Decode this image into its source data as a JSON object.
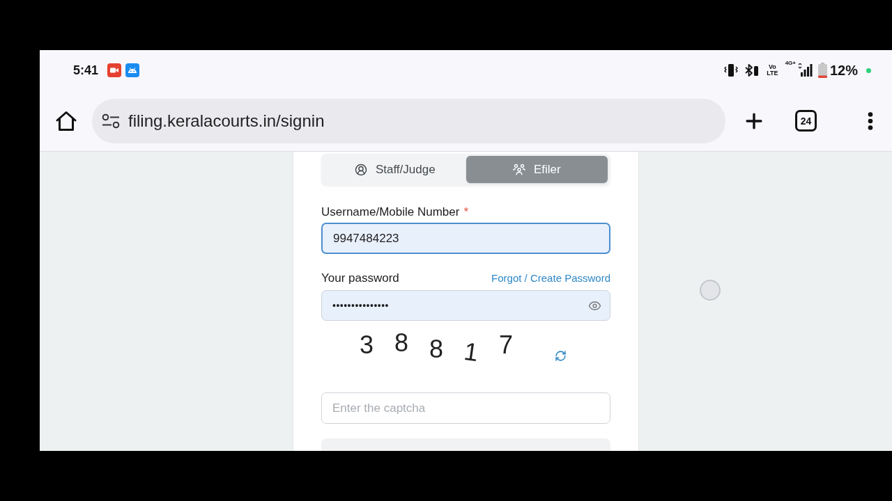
{
  "status_bar": {
    "time": "5:41",
    "volte": [
      "Vo",
      "LTE"
    ],
    "network": "4G+",
    "battery": "12%"
  },
  "browser": {
    "url": "filing.keralacourts.in/signin",
    "tab_count": "24"
  },
  "login_form": {
    "tabs": [
      {
        "label": "Staff/Judge",
        "selected": false
      },
      {
        "label": "Efiler",
        "selected": true
      }
    ],
    "username": {
      "label": "Username/Mobile Number",
      "required_mark": "*",
      "value": "9947484223",
      "focused": true
    },
    "password": {
      "label": "Your password",
      "link": "Forgot / Create Password",
      "value": "•••••••••••••••"
    },
    "captcha": {
      "digits": [
        "3",
        "8",
        "8",
        "1",
        "7"
      ]
    },
    "captcha_field": {
      "placeholder": "Enter the captcha"
    }
  }
}
